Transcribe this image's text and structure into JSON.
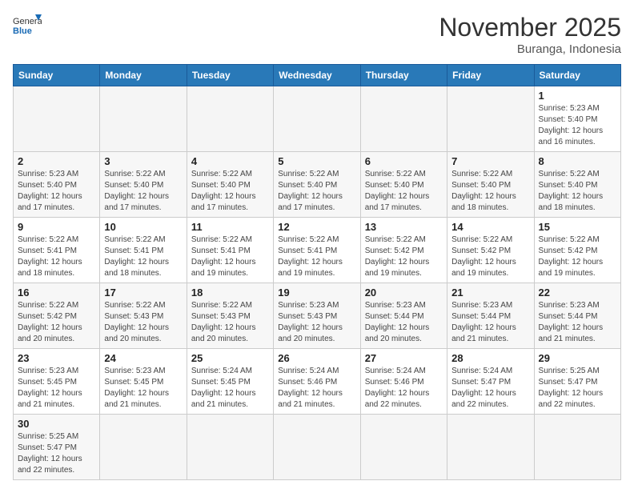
{
  "header": {
    "logo_general": "General",
    "logo_blue": "Blue",
    "month_title": "November 2025",
    "location": "Buranga, Indonesia"
  },
  "weekdays": [
    "Sunday",
    "Monday",
    "Tuesday",
    "Wednesday",
    "Thursday",
    "Friday",
    "Saturday"
  ],
  "weeks": [
    [
      {
        "day": "",
        "info": "",
        "empty": true
      },
      {
        "day": "",
        "info": "",
        "empty": true
      },
      {
        "day": "",
        "info": "",
        "empty": true
      },
      {
        "day": "",
        "info": "",
        "empty": true
      },
      {
        "day": "",
        "info": "",
        "empty": true
      },
      {
        "day": "",
        "info": "",
        "empty": true
      },
      {
        "day": "1",
        "info": "Sunrise: 5:23 AM\nSunset: 5:40 PM\nDaylight: 12 hours and 16 minutes."
      }
    ],
    [
      {
        "day": "2",
        "info": "Sunrise: 5:23 AM\nSunset: 5:40 PM\nDaylight: 12 hours and 17 minutes."
      },
      {
        "day": "3",
        "info": "Sunrise: 5:22 AM\nSunset: 5:40 PM\nDaylight: 12 hours and 17 minutes."
      },
      {
        "day": "4",
        "info": "Sunrise: 5:22 AM\nSunset: 5:40 PM\nDaylight: 12 hours and 17 minutes."
      },
      {
        "day": "5",
        "info": "Sunrise: 5:22 AM\nSunset: 5:40 PM\nDaylight: 12 hours and 17 minutes."
      },
      {
        "day": "6",
        "info": "Sunrise: 5:22 AM\nSunset: 5:40 PM\nDaylight: 12 hours and 17 minutes."
      },
      {
        "day": "7",
        "info": "Sunrise: 5:22 AM\nSunset: 5:40 PM\nDaylight: 12 hours and 18 minutes."
      },
      {
        "day": "8",
        "info": "Sunrise: 5:22 AM\nSunset: 5:40 PM\nDaylight: 12 hours and 18 minutes."
      }
    ],
    [
      {
        "day": "9",
        "info": "Sunrise: 5:22 AM\nSunset: 5:41 PM\nDaylight: 12 hours and 18 minutes."
      },
      {
        "day": "10",
        "info": "Sunrise: 5:22 AM\nSunset: 5:41 PM\nDaylight: 12 hours and 18 minutes."
      },
      {
        "day": "11",
        "info": "Sunrise: 5:22 AM\nSunset: 5:41 PM\nDaylight: 12 hours and 19 minutes."
      },
      {
        "day": "12",
        "info": "Sunrise: 5:22 AM\nSunset: 5:41 PM\nDaylight: 12 hours and 19 minutes."
      },
      {
        "day": "13",
        "info": "Sunrise: 5:22 AM\nSunset: 5:42 PM\nDaylight: 12 hours and 19 minutes."
      },
      {
        "day": "14",
        "info": "Sunrise: 5:22 AM\nSunset: 5:42 PM\nDaylight: 12 hours and 19 minutes."
      },
      {
        "day": "15",
        "info": "Sunrise: 5:22 AM\nSunset: 5:42 PM\nDaylight: 12 hours and 19 minutes."
      }
    ],
    [
      {
        "day": "16",
        "info": "Sunrise: 5:22 AM\nSunset: 5:42 PM\nDaylight: 12 hours and 20 minutes."
      },
      {
        "day": "17",
        "info": "Sunrise: 5:22 AM\nSunset: 5:43 PM\nDaylight: 12 hours and 20 minutes."
      },
      {
        "day": "18",
        "info": "Sunrise: 5:22 AM\nSunset: 5:43 PM\nDaylight: 12 hours and 20 minutes."
      },
      {
        "day": "19",
        "info": "Sunrise: 5:23 AM\nSunset: 5:43 PM\nDaylight: 12 hours and 20 minutes."
      },
      {
        "day": "20",
        "info": "Sunrise: 5:23 AM\nSunset: 5:44 PM\nDaylight: 12 hours and 20 minutes."
      },
      {
        "day": "21",
        "info": "Sunrise: 5:23 AM\nSunset: 5:44 PM\nDaylight: 12 hours and 21 minutes."
      },
      {
        "day": "22",
        "info": "Sunrise: 5:23 AM\nSunset: 5:44 PM\nDaylight: 12 hours and 21 minutes."
      }
    ],
    [
      {
        "day": "23",
        "info": "Sunrise: 5:23 AM\nSunset: 5:45 PM\nDaylight: 12 hours and 21 minutes."
      },
      {
        "day": "24",
        "info": "Sunrise: 5:23 AM\nSunset: 5:45 PM\nDaylight: 12 hours and 21 minutes."
      },
      {
        "day": "25",
        "info": "Sunrise: 5:24 AM\nSunset: 5:45 PM\nDaylight: 12 hours and 21 minutes."
      },
      {
        "day": "26",
        "info": "Sunrise: 5:24 AM\nSunset: 5:46 PM\nDaylight: 12 hours and 21 minutes."
      },
      {
        "day": "27",
        "info": "Sunrise: 5:24 AM\nSunset: 5:46 PM\nDaylight: 12 hours and 22 minutes."
      },
      {
        "day": "28",
        "info": "Sunrise: 5:24 AM\nSunset: 5:47 PM\nDaylight: 12 hours and 22 minutes."
      },
      {
        "day": "29",
        "info": "Sunrise: 5:25 AM\nSunset: 5:47 PM\nDaylight: 12 hours and 22 minutes."
      }
    ],
    [
      {
        "day": "30",
        "info": "Sunrise: 5:25 AM\nSunset: 5:47 PM\nDaylight: 12 hours and 22 minutes."
      },
      {
        "day": "",
        "info": "",
        "empty": true
      },
      {
        "day": "",
        "info": "",
        "empty": true
      },
      {
        "day": "",
        "info": "",
        "empty": true
      },
      {
        "day": "",
        "info": "",
        "empty": true
      },
      {
        "day": "",
        "info": "",
        "empty": true
      },
      {
        "day": "",
        "info": "",
        "empty": true
      }
    ]
  ]
}
